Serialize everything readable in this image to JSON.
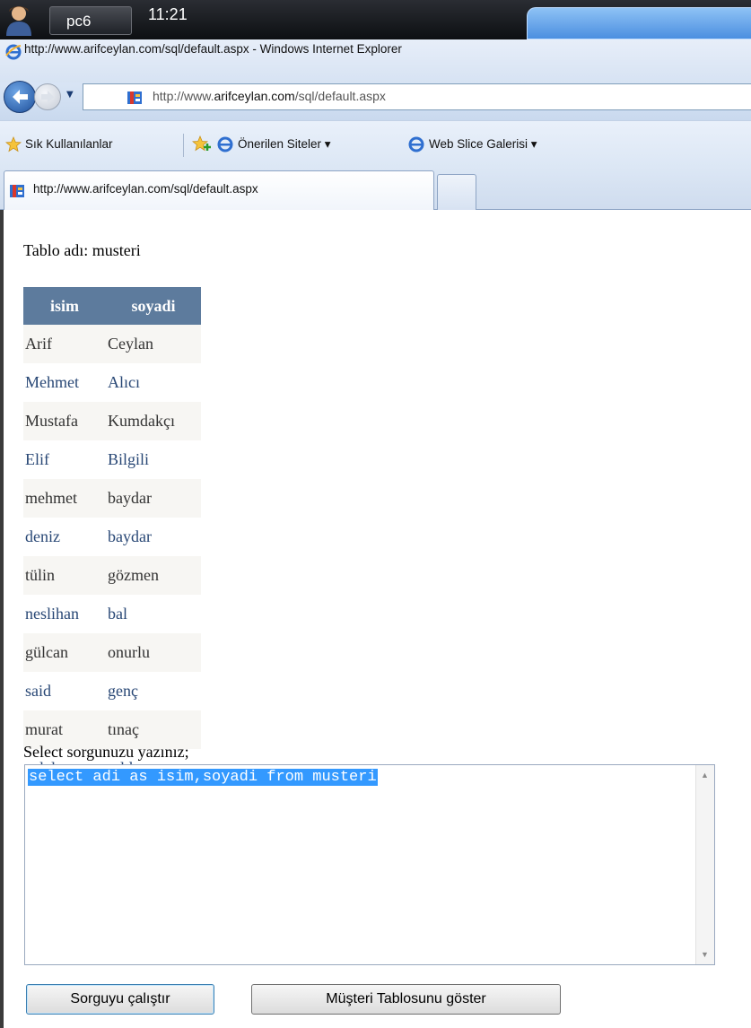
{
  "taskbar": {
    "user_tab": "pc6",
    "clock": "11:21"
  },
  "window": {
    "title": "http://www.arifceylan.com/sql/default.aspx - Windows Internet Explorer"
  },
  "address": {
    "url_prefix": "http://www.",
    "url_domain": "arifceylan.com",
    "url_path": "/sql/default.aspx"
  },
  "favorites_bar": {
    "favorites_label": "Sık Kullanılanlar",
    "suggested_sites": "Önerilen Siteler",
    "web_slice_gallery": "Web Slice Galerisi"
  },
  "tab": {
    "label": "http://www.arifceylan.com/sql/default.aspx"
  },
  "page": {
    "table_name_label": "Tablo adı: musteri",
    "columns": [
      "isim",
      "soyadi"
    ],
    "rows": [
      [
        "Arif",
        "Ceylan"
      ],
      [
        "Mehmet",
        "Alıcı"
      ],
      [
        "Mustafa",
        "Kumdakçı"
      ],
      [
        "Elif",
        "Bilgili"
      ],
      [
        "mehmet",
        "baydar"
      ],
      [
        "deniz",
        "baydar"
      ],
      [
        "tülin",
        "gözmen"
      ],
      [
        "neslihan",
        "bal"
      ],
      [
        "gülcan",
        "onurlu"
      ],
      [
        "said",
        "genç"
      ],
      [
        "murat",
        "tınaç"
      ],
      [
        "celal",
        "yıldırım"
      ]
    ],
    "query_prompt": "Select sorgunuzu yazınız;",
    "query_value": "select adi as isim,soyadi from musteri",
    "run_button": "Sorguyu çalıştır",
    "show_table_button": "Müşteri Tablosunu göster"
  }
}
